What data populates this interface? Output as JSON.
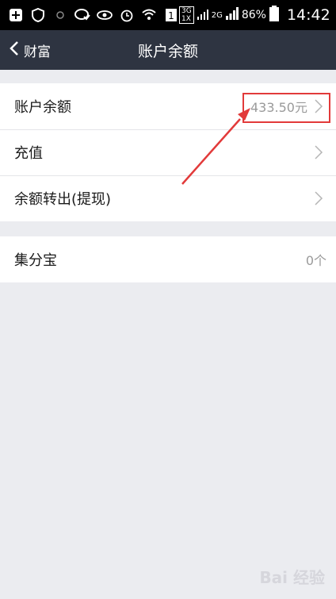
{
  "status_bar": {
    "battery_percent": "86%",
    "time": "14:42",
    "network_3g": "3G",
    "network_1x": "1X",
    "network_2g": "2G",
    "sim_indicator": "1"
  },
  "nav": {
    "back_label": "财富",
    "title": "账户余额"
  },
  "balance_group": {
    "rows": [
      {
        "label": "账户余额",
        "value": "433.50元"
      },
      {
        "label": "充值",
        "value": ""
      },
      {
        "label": "余额转出(提现)",
        "value": ""
      }
    ]
  },
  "points_group": {
    "rows": [
      {
        "label": "集分宝",
        "value": "0个"
      }
    ]
  },
  "watermark": "Bai 经验",
  "colors": {
    "nav_bg": "#2e3441",
    "page_bg": "#ebecf0",
    "annotation_red": "#e23a3a"
  }
}
